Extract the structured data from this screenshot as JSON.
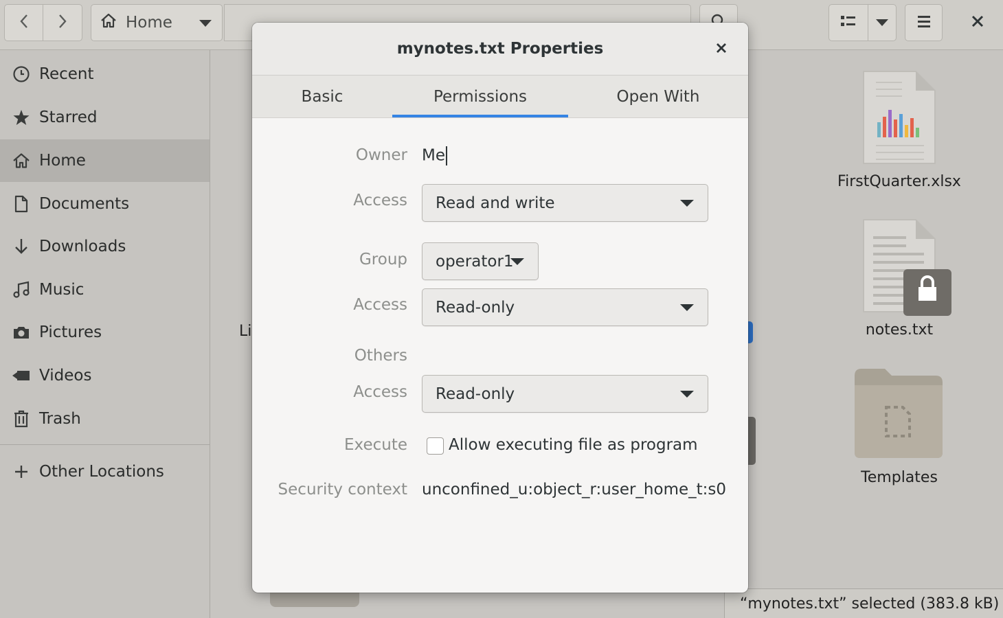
{
  "header": {
    "path_label": "Home",
    "back_icon": "chevron-left-icon",
    "forward_icon": "chevron-right-icon"
  },
  "sidebar": {
    "items": [
      {
        "label": "Recent",
        "icon": "clock-icon"
      },
      {
        "label": "Starred",
        "icon": "star-icon"
      },
      {
        "label": "Home",
        "icon": "home-icon",
        "active": true
      },
      {
        "label": "Documents",
        "icon": "document-icon"
      },
      {
        "label": "Downloads",
        "icon": "download-arrow-icon"
      },
      {
        "label": "Music",
        "icon": "music-note-icon"
      },
      {
        "label": "Pictures",
        "icon": "camera-icon"
      },
      {
        "label": "Videos",
        "icon": "video-camera-icon"
      },
      {
        "label": "Trash",
        "icon": "trash-icon"
      }
    ],
    "other_locations": "Other Locations"
  },
  "files": {
    "partial_label": "Li",
    "items": [
      {
        "name": "FirstQuarter.xlsx",
        "icon": "spreadsheet-file-icon"
      },
      {
        "name": "notes.txt",
        "icon": "locked-text-file-icon"
      },
      {
        "name": "Templates",
        "icon": "templates-folder-icon"
      }
    ]
  },
  "status_bar": {
    "text": "“mynotes.txt” selected  (383.8 kB)"
  },
  "dialog": {
    "title": "mynotes.txt Properties",
    "tabs": [
      "Basic",
      "Permissions",
      "Open With"
    ],
    "active_tab": "Permissions",
    "owner_label": "Owner",
    "owner_value": "Me",
    "owner_access_label": "Access",
    "owner_access": "Read and write",
    "group_label": "Group",
    "group_value": "operator1",
    "group_access_label": "Access",
    "group_access": "Read-only",
    "others_label": "Others",
    "others_access_label": "Access",
    "others_access": "Read-only",
    "execute_label": "Execute",
    "execute_checkbox_label": "Allow executing file as program",
    "execute_checked": false,
    "security_label": "Security context",
    "security_value": "unconfined_u:object_r:user_home_t:s0"
  },
  "colors": {
    "accent": "#3584e4",
    "dialog_bg": "#f6f5f4",
    "backdrop": "#c7c5c1"
  }
}
